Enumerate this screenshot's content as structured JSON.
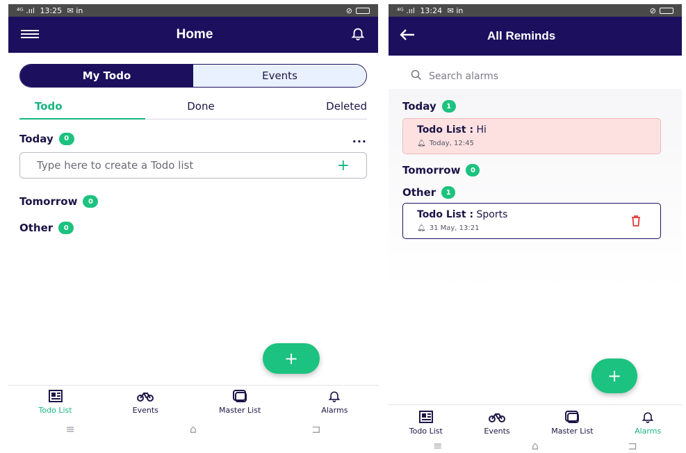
{
  "left": {
    "status": {
      "time": "13:25",
      "left_icons": "⁴ᴳ .ııl",
      "apps": "✉ in"
    },
    "header": {
      "title": "Home"
    },
    "segments": {
      "my_todo": "My Todo",
      "events": "Events"
    },
    "tabs": [
      "Todo",
      "Done",
      "Deleted"
    ],
    "sections": {
      "today": {
        "label": "Today",
        "count": "0"
      },
      "tomorrow": {
        "label": "Tomorrow",
        "count": "0"
      },
      "other": {
        "label": "Other",
        "count": "0"
      }
    },
    "more_label": "...",
    "new_todo": {
      "placeholder": "Type here to create a Todo list",
      "plus": "+"
    },
    "fab": "+",
    "nav": {
      "todo_list": "Todo List",
      "events": "Events",
      "master_list": "Master List",
      "alarms": "Alarms"
    }
  },
  "right": {
    "status": {
      "time": "13:24",
      "left_icons": "⁴ᴳ .ııl",
      "apps": "✉ in"
    },
    "header": {
      "title": "All Reminds"
    },
    "search": {
      "placeholder": "Search alarms"
    },
    "sections": {
      "today": {
        "label": "Today",
        "count": "1"
      },
      "tomorrow": {
        "label": "Tomorrow",
        "count": "0"
      },
      "other": {
        "label": "Other",
        "count": "1"
      }
    },
    "reminders": [
      {
        "prefix": "Todo List :",
        "name": "Hi",
        "when": "Today, 12:45"
      },
      {
        "prefix": "Todo List :",
        "name": "Sports",
        "when": "31 May, 13:21"
      }
    ],
    "fab": "+",
    "nav": {
      "todo_list": "Todo List",
      "events": "Events",
      "master_list": "Master List",
      "alarms": "Alarms"
    }
  },
  "colors": {
    "primary": "#1c0f5e",
    "accent": "#1cc27f",
    "today_card": "#fde1e1",
    "delete": "#e53935"
  }
}
